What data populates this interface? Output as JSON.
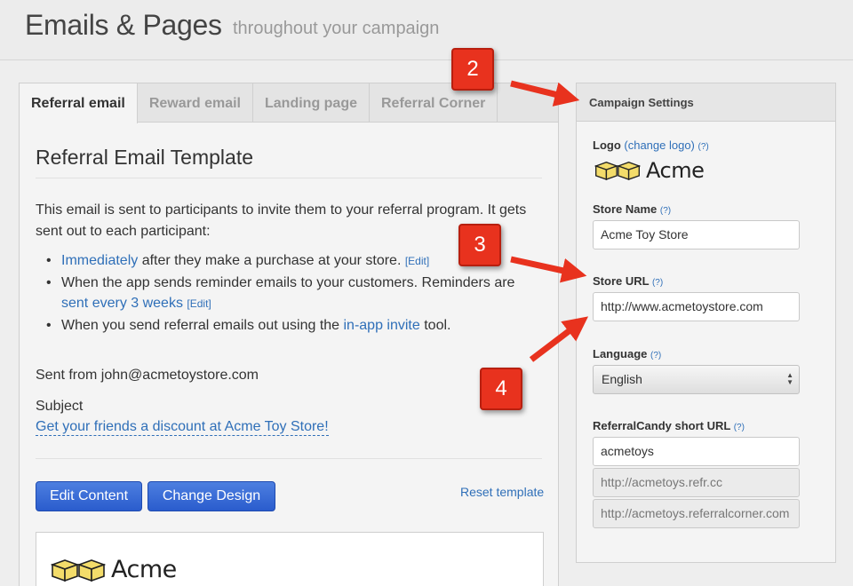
{
  "header": {
    "title": "Emails & Pages",
    "subtitle": "throughout your campaign"
  },
  "tabs": [
    {
      "label": "Referral email",
      "active": true
    },
    {
      "label": "Reward email",
      "active": false
    },
    {
      "label": "Landing page",
      "active": false
    },
    {
      "label": "Referral Corner",
      "active": false
    }
  ],
  "template": {
    "title": "Referral Email Template",
    "description": "This email is sent to participants to invite them to your referral program. It gets sent out to each participant:",
    "bullets": [
      {
        "link": "Immediately",
        "text": " after they make a purchase at your store. ",
        "edit": "[Edit]"
      },
      {
        "text": "When the app sends reminder emails to your customers. Reminders are ",
        "link": "sent every 3 weeks",
        "edit": "[Edit]"
      },
      {
        "text": "When you send referral emails out using the ",
        "link": "in-app invite",
        "text2": " tool."
      }
    ],
    "sent_from": "Sent from john@acmetoystore.com",
    "subject_label": "Subject",
    "subject_value": "Get your friends a discount at Acme Toy Store!",
    "edit_content_label": "Edit Content",
    "change_design_label": "Change Design",
    "reset_label": "Reset template",
    "preview_logo_text": "Acme"
  },
  "settings": {
    "header": "Campaign Settings",
    "logo_label": "Logo",
    "change_logo": "(change logo)",
    "help": "(?)",
    "logo_text": "Acme",
    "store_name_label": "Store Name",
    "store_name_value": "Acme Toy Store",
    "store_url_label": "Store URL",
    "store_url_value": "http://www.acmetoystore.com",
    "language_label": "Language",
    "language_value": "English",
    "short_url_label": "ReferralCandy short URL",
    "short_url_value": "acmetoys",
    "refr_url": "http://acmetoys.refr.cc",
    "corner_url": "http://acmetoys.referralcorner.com"
  },
  "callouts": [
    "2",
    "3",
    "4"
  ],
  "colors": {
    "accent": "#2a5ccd",
    "link": "#2f6fb8",
    "callout": "#e8321e",
    "logo_yellow": "#f3dc6a"
  }
}
